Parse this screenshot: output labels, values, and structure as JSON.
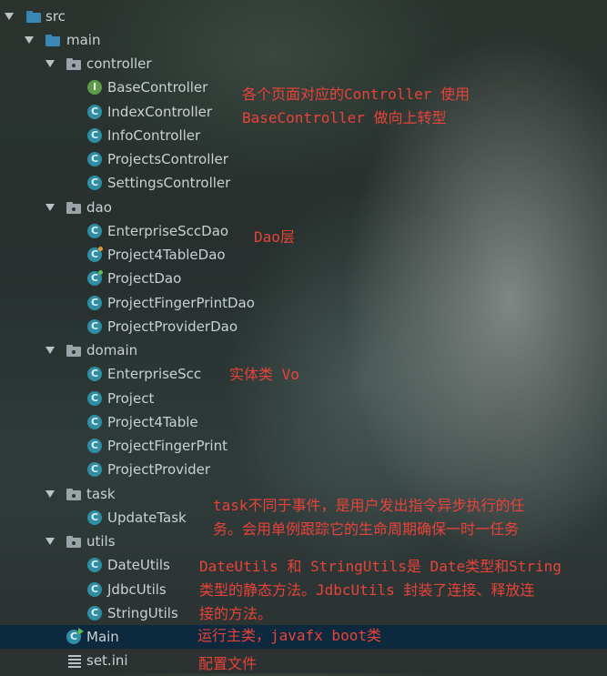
{
  "tree": {
    "src": "src",
    "main": "main",
    "controller": {
      "label": "controller",
      "items": [
        "BaseController",
        "IndexController",
        "InfoController",
        "ProjectsController",
        "SettingsController"
      ]
    },
    "dao": {
      "label": "dao",
      "items": [
        "EnterpriseSccDao",
        "Project4TableDao",
        "ProjectDao",
        "ProjectFingerPrintDao",
        "ProjectProviderDao"
      ]
    },
    "domain": {
      "label": "domain",
      "items": [
        "EnterpriseScc",
        "Project",
        "Project4Table",
        "ProjectFingerPrint",
        "ProjectProvider"
      ]
    },
    "task": {
      "label": "task",
      "items": [
        "UpdateTask"
      ]
    },
    "utils": {
      "label": "utils",
      "items": [
        "DateUtils",
        "JdbcUtils",
        "StringUtils"
      ]
    },
    "main_class": "Main",
    "ini_file": "set.ini"
  },
  "notes": {
    "controller_line1": "各个页面对应的Controller 使用",
    "controller_line2": "BaseController 做向上转型",
    "dao": "Dao层",
    "domain": "实体类 Vo",
    "task_line1": "task不同于事件，是用户发出指令异步执行的任",
    "task_line2": "务。会用单例跟踪它的生命周期确保一时一任务",
    "utils_line1": "DateUtils 和 StringUtils是 Date类型和String",
    "utils_line2": "类型的静态方法。JdbcUtils 封装了连接、释放连",
    "utils_line3": "接的方法。",
    "main": "运行主类，javafx boot类",
    "ini": "配置文件"
  },
  "colors": {
    "annotation": "#e8433a",
    "selected_row": "#0d293e",
    "class_icon": "#2f8ea3",
    "interface_icon": "#5d9b4b"
  },
  "icons": {
    "folder": "folder-icon",
    "package": "package-icon",
    "class": "class-icon",
    "interface": "interface-icon",
    "main": "main-class-icon",
    "ini": "settings-file-icon"
  }
}
